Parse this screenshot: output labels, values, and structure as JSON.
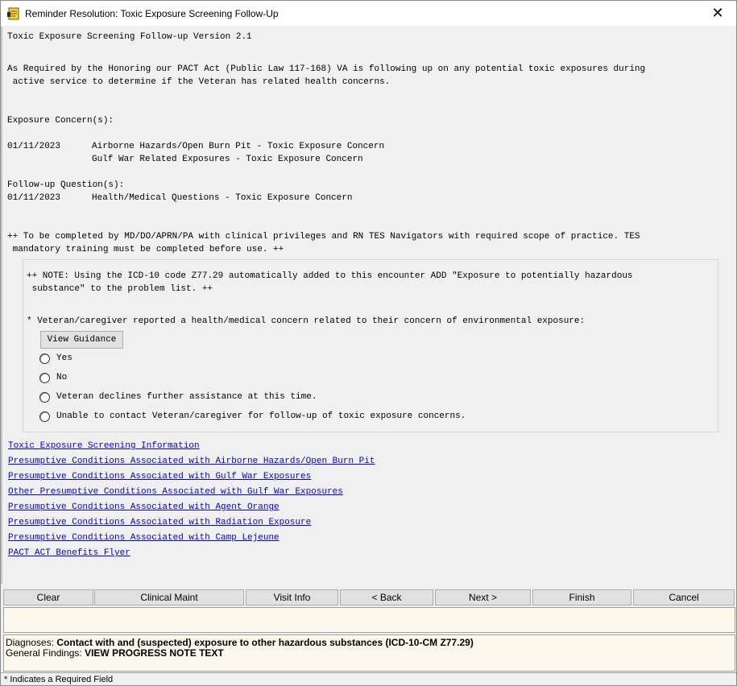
{
  "window": {
    "title": "Reminder Resolution: Toxic Exposure Screening Follow-Up",
    "close_glyph": "✕",
    "icon": "notepad-icon"
  },
  "body": {
    "header": "Toxic Exposure Screening Follow-up Version 2.1",
    "intro_line1": "As Required by the Honoring our PACT Act (Public Law 117-168) VA is following up on any potential toxic exposures during",
    "intro_line2": " active service to determine if the Veteran has related health concerns.",
    "concerns_heading": "Exposure Concern(s):",
    "concern1_date": "01/11/2023",
    "concern1_text": "Airborne Hazards/Open Burn Pit - Toxic Exposure Concern",
    "concern2_text": "Gulf War Related Exposures - Toxic Exposure Concern",
    "followup_heading": "Follow-up Question(s):",
    "followup1_date": "01/11/2023",
    "followup1_text": "Health/Medical Questions - Toxic Exposure Concern",
    "note_line1": "++ To be completed by MD/DO/APRN/PA with clinical privileges and RN TES Navigators with required scope of practice. TES",
    "note_line2": " mandatory training must be completed before use. ++"
  },
  "group": {
    "note_line1": "++ NOTE: Using the ICD-10 code Z77.29 automatically added to this encounter ADD \"Exposure to potentially hazardous",
    "note_line2": " substance\" to the problem list. ++",
    "question": "* Veteran/caregiver reported a health/medical concern related to their concern of environmental exposure:",
    "guidance_button": "View Guidance",
    "options": [
      "Yes",
      "No",
      "Veteran declines further assistance at this time.",
      "Unable to contact Veteran/caregiver for follow-up of toxic exposure concerns."
    ]
  },
  "links": [
    "Toxic Exposure Screening Information",
    "Presumptive Conditions Associated with Airborne Hazards/Open Burn Pit",
    "Presumptive Conditions Associated with Gulf War Exposures",
    "Other Presumptive Conditions Associated with Gulf War Exposures",
    "Presumptive Conditions Associated with Agent Orange",
    "Presumptive Conditions Associated with Radiation Exposure",
    "Presumptive Conditions Associated with Camp Lejeune",
    "PACT ACT Benefits Flyer"
  ],
  "buttons": {
    "clear": "Clear",
    "clinical_maint": "Clinical Maint",
    "visit_info": "Visit Info",
    "back": "< Back",
    "next": "Next >",
    "finish": "Finish",
    "cancel": "Cancel"
  },
  "findings": {
    "diagnoses_label": "Diagnoses:",
    "diagnoses_value": "Contact with and (suspected) exposure to other hazardous substances (ICD-10-CM Z77.29)",
    "general_label": "General Findings:",
    "general_value": "VIEW PROGRESS NOTE TEXT"
  },
  "status": {
    "required_note": "* Indicates a Required Field"
  },
  "colors": {
    "link": "#0000ee",
    "panel_bg": "#fdf8ec",
    "window_bg": "#f0f0f0"
  }
}
